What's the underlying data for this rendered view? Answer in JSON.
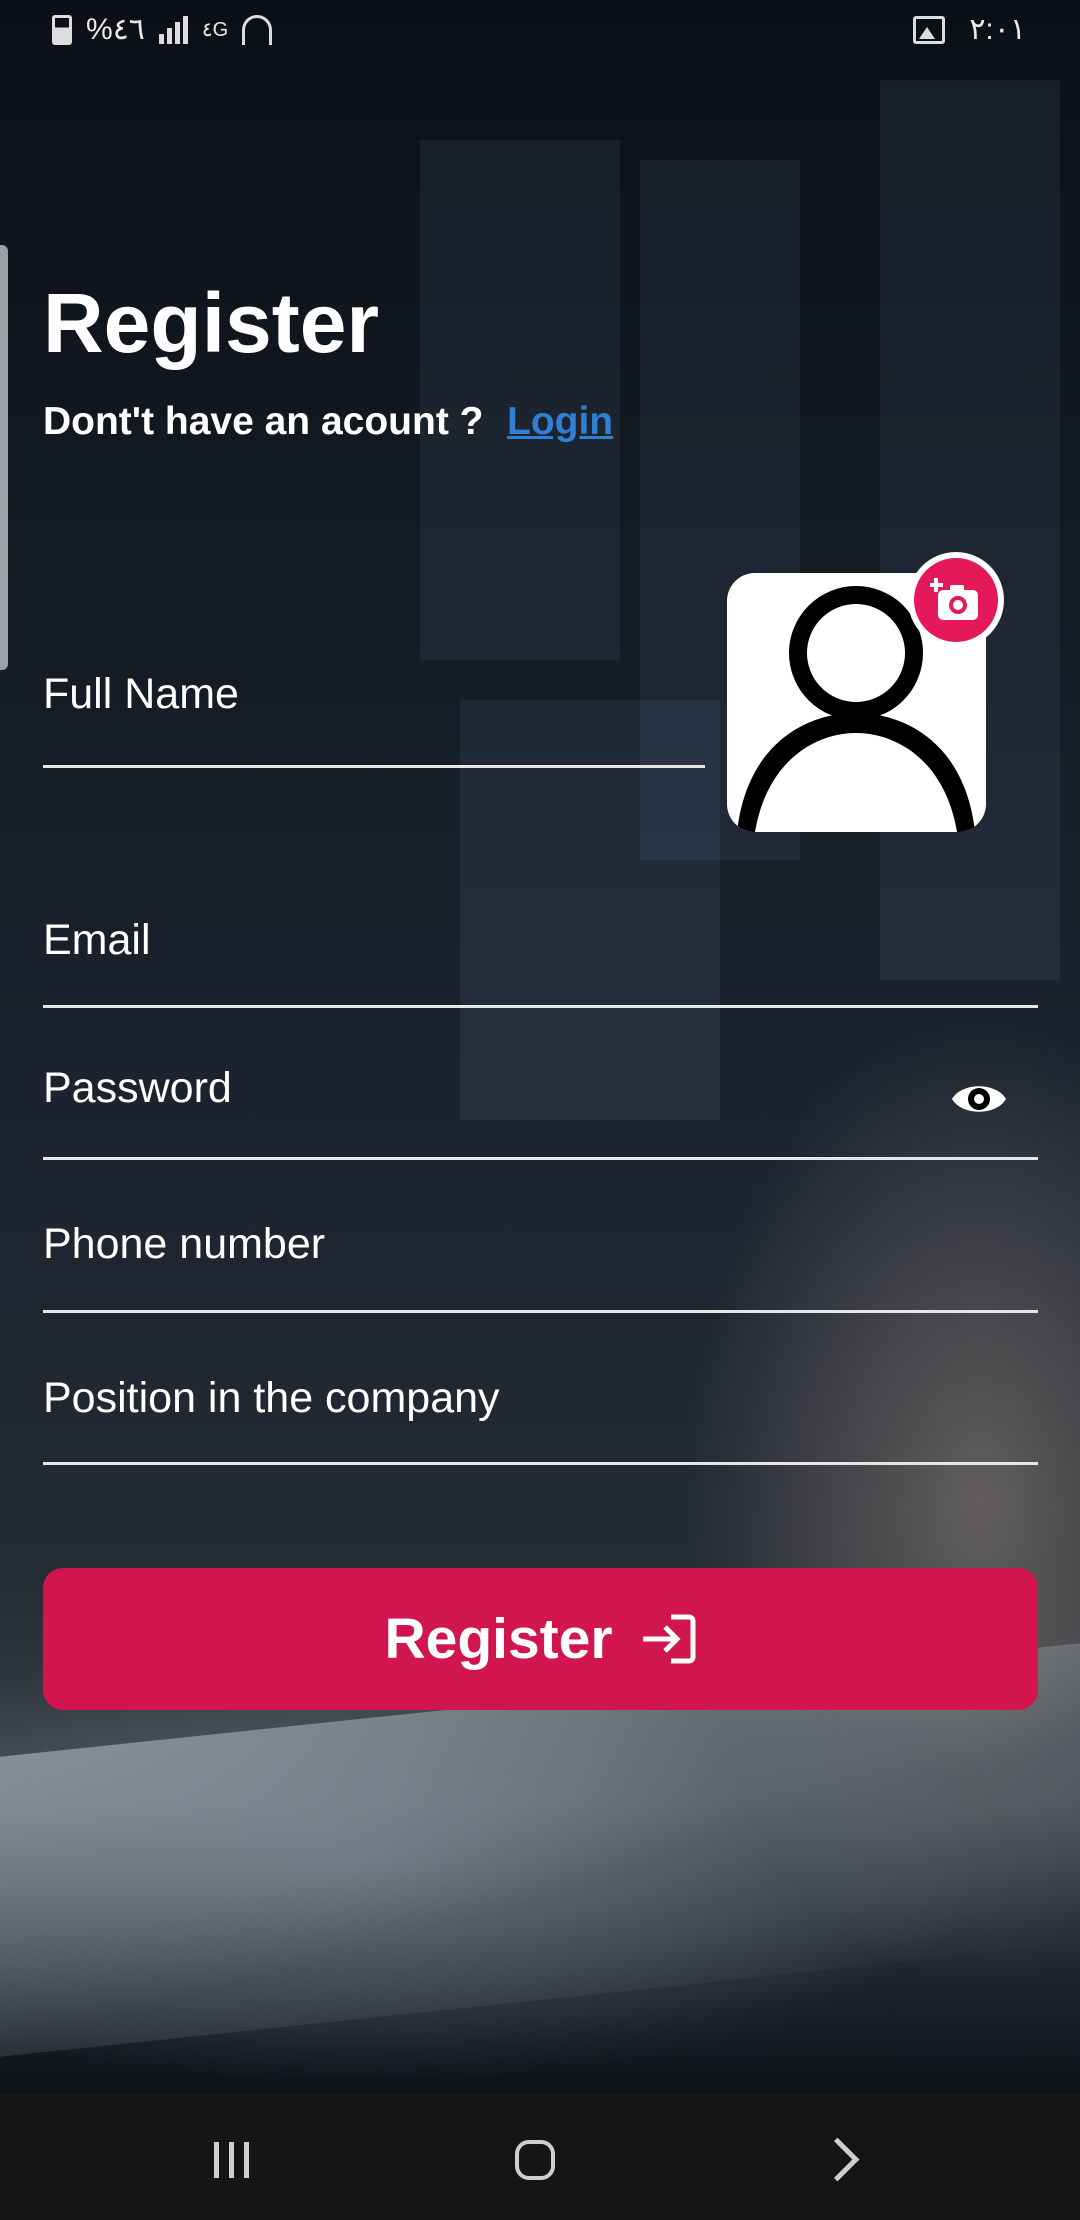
{
  "status_bar": {
    "battery_percent": "%٤٦",
    "network": "٤G",
    "time": "٢:٠١"
  },
  "header": {
    "title": "Register",
    "subtitle": "Dont't have an acount ?",
    "login_link": "Login"
  },
  "form": {
    "full_name_placeholder": "Full Name",
    "email_placeholder": "Email",
    "password_placeholder": "Password",
    "phone_placeholder": "Phone number",
    "position_placeholder": "Position in the company"
  },
  "register_button": {
    "label": "Register",
    "icon": "login-arrow-icon"
  },
  "colors": {
    "accent": "#d0154f",
    "link": "#2f7fd4",
    "camera_badge": "#e3195a"
  },
  "icons": {
    "avatar": "user-placeholder-icon",
    "camera": "add-photo-camera-icon",
    "password_toggle": "eye-icon"
  }
}
